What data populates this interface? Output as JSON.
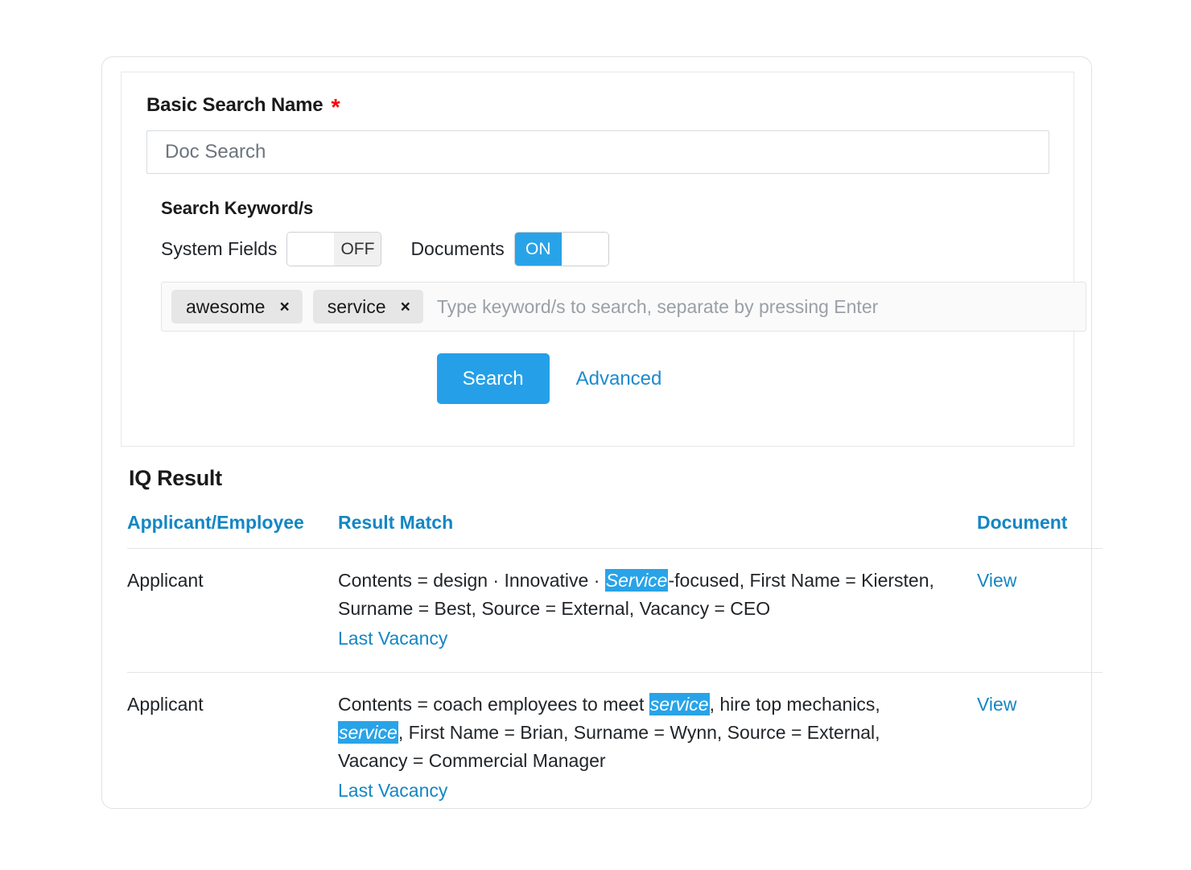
{
  "form": {
    "basic_search_name_label": "Basic Search Name",
    "required_marker": "*",
    "search_name_value": "Doc Search",
    "search_name_placeholder": "Doc Search",
    "keywords_label": "Search Keyword/s",
    "toggles": [
      {
        "label": "System Fields",
        "state": "OFF",
        "on_text": "ON",
        "off_text": "OFF"
      },
      {
        "label": "Documents",
        "state": "ON",
        "on_text": "ON",
        "off_text": "OFF"
      }
    ],
    "keyword_chips": [
      {
        "label": "awesome",
        "remove": "×"
      },
      {
        "label": "service",
        "remove": "×"
      }
    ],
    "keyword_placeholder": "Type keyword/s to search, separate by pressing Enter",
    "keyword_value": "",
    "search_button_label": "Search",
    "advanced_link_label": "Advanced"
  },
  "results": {
    "title": "IQ Result",
    "columns": [
      "Applicant/Employee",
      "Result Match",
      "Document"
    ],
    "rows": [
      {
        "type": "Applicant",
        "match_segments": [
          {
            "text": "Contents = design · Innovative · ",
            "highlight": false
          },
          {
            "text": "Service",
            "highlight": true
          },
          {
            "text": "-focused, First Name = Kiersten, Surname = Best, Source = External, Vacancy = CEO",
            "highlight": false
          }
        ],
        "match_link": "Last Vacancy",
        "document": "View"
      },
      {
        "type": "Applicant",
        "match_segments": [
          {
            "text": "Contents = coach employees to meet ",
            "highlight": false
          },
          {
            "text": "service",
            "highlight": true
          },
          {
            "text": ", hire top mechanics, ",
            "highlight": false
          },
          {
            "text": "service",
            "highlight": true
          },
          {
            "text": ", First Name = Brian, Surname = Wynn, Source = External, Vacancy = Commercial Manager",
            "highlight": false
          }
        ],
        "match_link": "Last Vacancy",
        "document": "View"
      }
    ]
  },
  "colors": {
    "accent_blue": "#25a0e8",
    "link_blue": "#1486c4",
    "highlight_blue": "#29a3e8",
    "required_red": "#ff0000"
  }
}
